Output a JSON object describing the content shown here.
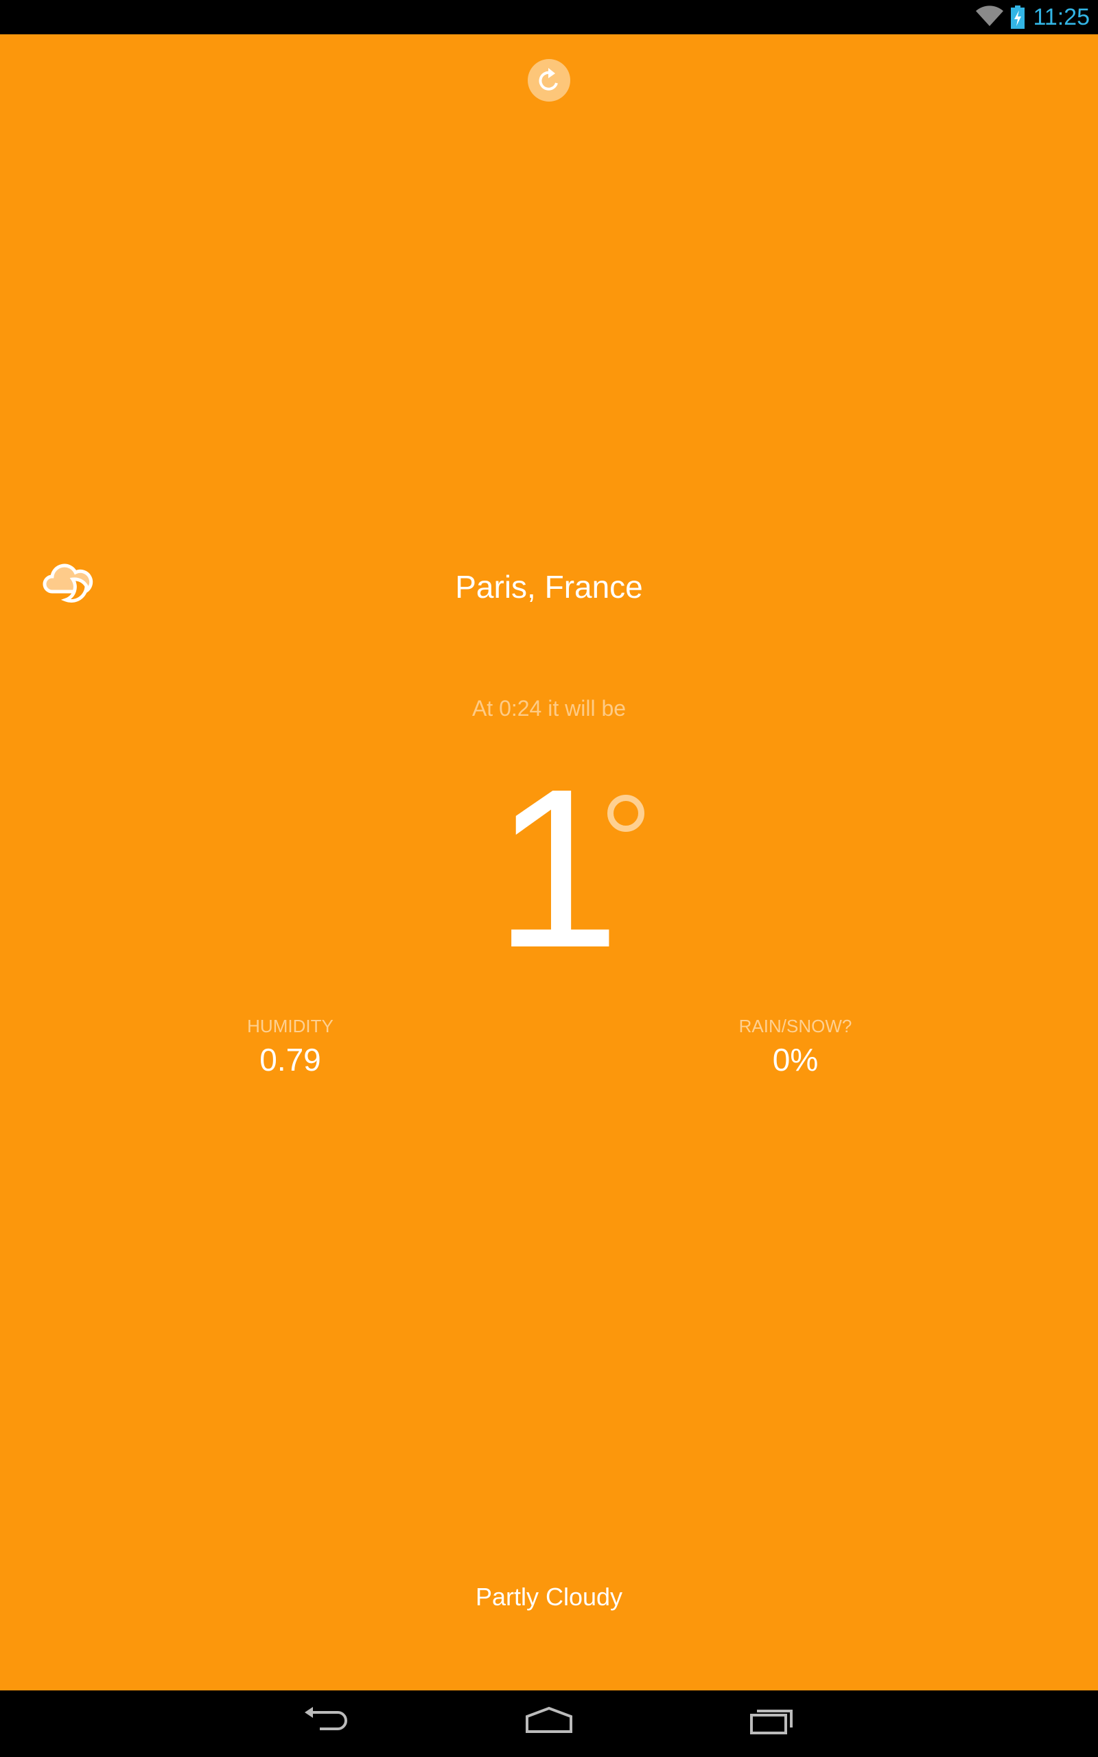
{
  "status_bar": {
    "time": "11:25",
    "icons": [
      "wifi-icon",
      "battery-charging-icon"
    ],
    "time_color": "#33b5e5"
  },
  "toolbar": {
    "refresh_icon": "refresh-icon"
  },
  "weather": {
    "icon": "partly-cloudy-night-icon",
    "location": "Paris, France",
    "forecast_time_text": "At 0:24 it will be",
    "temperature": "1",
    "degree_icon": "degree-icon",
    "humidity_label": "HUMIDITY",
    "humidity_value": "0.79",
    "precip_label": "RAIN/SNOW?",
    "precip_value": "0%",
    "summary": "Partly Cloudy"
  },
  "colors": {
    "background": "#fc970c"
  },
  "nav_bar": {
    "icons": [
      "back-icon",
      "home-icon",
      "recent-apps-icon"
    ]
  }
}
